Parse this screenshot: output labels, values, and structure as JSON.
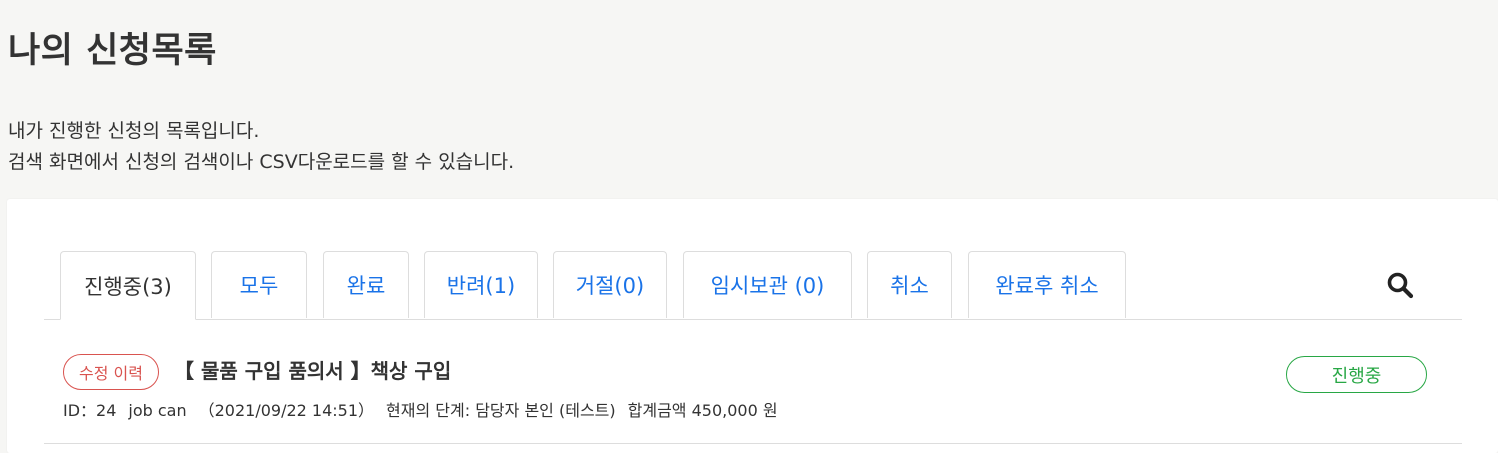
{
  "page": {
    "title": "나의 신청목록",
    "description_line1": "내가 진행한 신청의 목록입니다.",
    "description_line2": "검색 화면에서 신청의 검색이나 CSV다운로드를 할 수 있습니다."
  },
  "tabs": [
    {
      "label": "진행중(3)",
      "active": true
    },
    {
      "label": "모두",
      "active": false
    },
    {
      "label": "완료",
      "active": false
    },
    {
      "label": "반려(1)",
      "active": false
    },
    {
      "label": "거절(0)",
      "active": false
    },
    {
      "label": "임시보관 (0)",
      "active": false
    },
    {
      "label": "취소",
      "active": false
    },
    {
      "label": "완료후 취소",
      "active": false
    }
  ],
  "search": {
    "icon": "search-icon"
  },
  "items": [
    {
      "revision_badge": "수정 이력",
      "title": "【 물품 구입 품의서 】책상 구입",
      "id_text": "ID：24",
      "company": "job can",
      "datetime": "（2021/09/22 14:51）",
      "stage": "현재의 단계: 담당자 본인 (테스트)",
      "amount": "합계금액 450,000 원",
      "status": "진행중"
    }
  ],
  "colors": {
    "background": "#f6f6f4",
    "card": "#ffffff",
    "link_blue": "#1a73e8",
    "revision_red": "#d9534f",
    "status_green": "#28a745",
    "text": "#333333",
    "border": "#dddddd"
  }
}
